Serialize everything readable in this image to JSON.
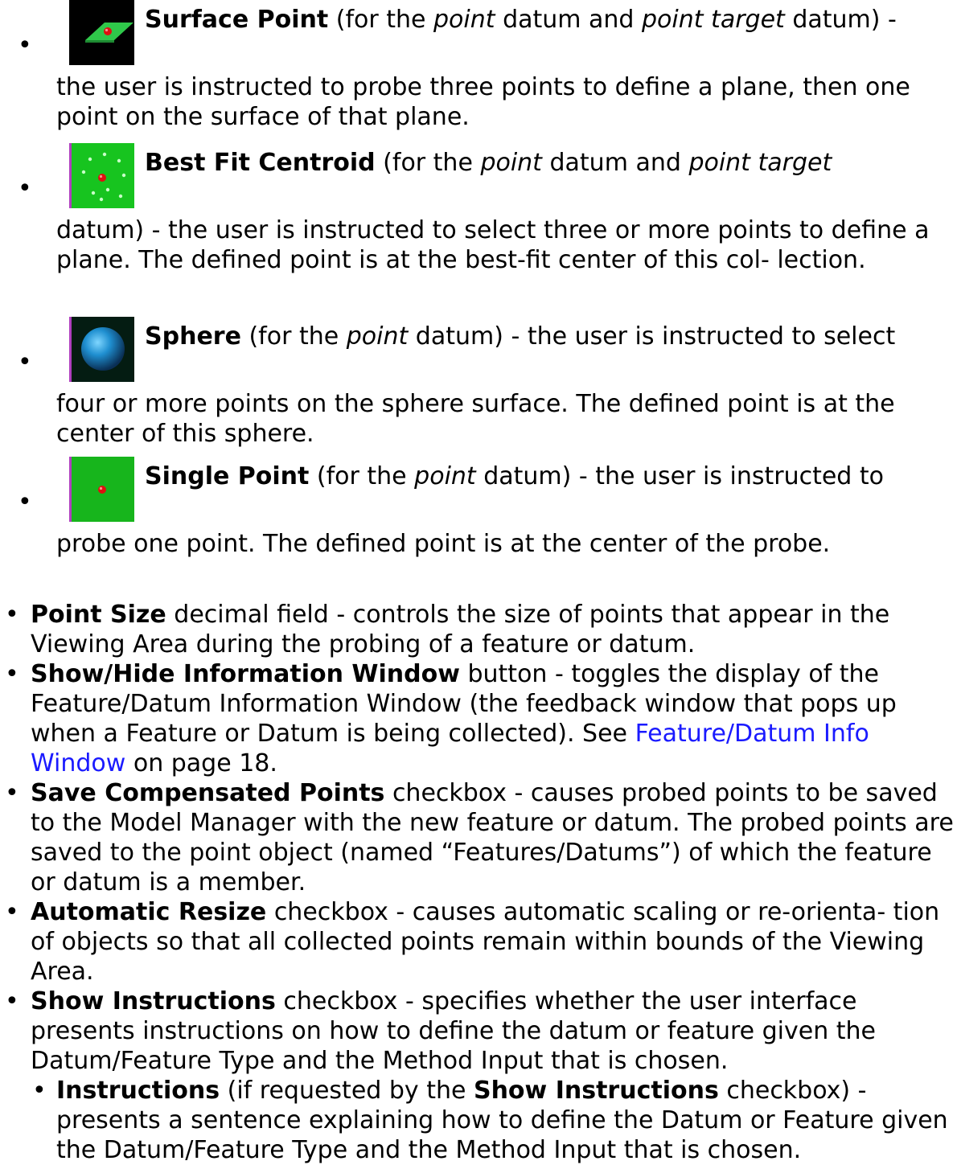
{
  "methods": [
    {
      "icon": "surface-point-icon",
      "name": "Surface Point",
      "pre": " (for the ",
      "em1": "point",
      "mid": " datum and ",
      "em2": "point target",
      "post": " datum) -",
      "body": "the user is instructed to probe three points to define a plane, then one point on the surface of that plane."
    },
    {
      "icon": "best-fit-centroid-icon",
      "name": "Best Fit Centroid",
      "pre": " (for the ",
      "em1": "point",
      "mid": " datum and ",
      "em2": "point target",
      "post": "",
      "body": "datum) - the user is instructed to select three or more points to define a plane. The defined point is at the best-fit center of this col- lection."
    },
    {
      "icon": "sphere-icon",
      "name": "Sphere",
      "pre": " (for the ",
      "em1": "point",
      "post": " datum) - the user is instructed to select",
      "body": "four or more points on the sphere surface. The defined point is at the center of this sphere."
    },
    {
      "icon": "single-point-icon",
      "name": "Single Point",
      "pre": " (for the ",
      "em1": "point",
      "post": " datum) - the user is instructed to",
      "body": "probe one point. The defined point is at the center of the probe."
    }
  ],
  "items": [
    {
      "term": "Point Size",
      "text": " decimal field - controls the size of points that appear in the Viewing Area during the probing of a feature or datum."
    },
    {
      "term": "Show/Hide Information Window",
      "text": " button - toggles the display of the Feature/Datum Information Window (the feedback window that pops up when a Feature or Datum is being collected). See ",
      "link": "Feature/Datum Info Window",
      "tail": " on page 18."
    },
    {
      "term": "Save Compensated Points",
      "text": " checkbox - causes probed points to be saved to the Model Manager with the new feature or datum. The probed points are saved to the point object (named “Features/Datums”) of which the feature or datum is a member."
    },
    {
      "term": "Automatic Resize",
      "text": " checkbox - causes automatic scaling or re-orienta- tion of objects so that all collected points remain within bounds of the Viewing Area."
    },
    {
      "term": "Show Instructions",
      "text": " checkbox - specifies whether the user interface presents instructions on how to define the datum or feature given the Datum/Feature Type and the Method Input that is chosen."
    }
  ],
  "subitem": {
    "term": "Instructions",
    "pre": " (if requested by the ",
    "term2": "Show Instructions",
    "text": " checkbox) - presents a sentence explaining how to define the Datum or Feature given the Datum/Feature Type and the Method Input that is chosen."
  },
  "bullet": "•"
}
